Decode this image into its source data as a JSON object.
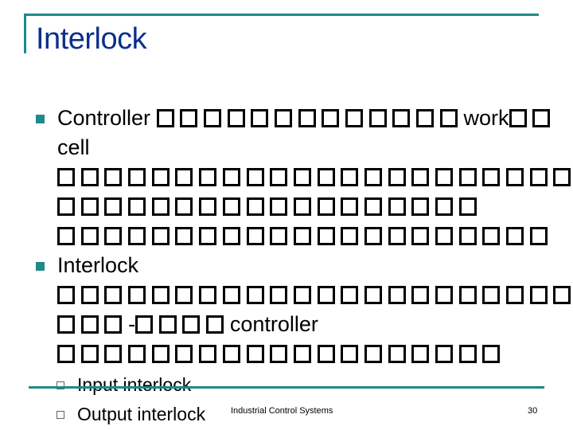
{
  "slide": {
    "title": "Interlock",
    "bullets": [
      {
        "lines": [
          {
            "segments": [
              {
                "text": "Controller "
              },
              {
                "tofu": 13
              },
              {
                "text": "work"
              },
              {
                "tofu": 2
              }
            ]
          },
          {
            "segments": [
              {
                "text": "cell"
              }
            ]
          },
          {
            "segments": [
              {
                "tofu": 22
              }
            ]
          },
          {
            "segments": [
              {
                "tofu": 18
              }
            ]
          },
          {
            "segments": [
              {
                "tofu": 21
              }
            ]
          }
        ],
        "plain_text": "Controller �������������work�� cell"
      },
      {
        "lines": [
          {
            "segments": [
              {
                "text": "Interlock"
              }
            ]
          },
          {
            "segments": [
              {
                "tofu": 22
              }
            ]
          },
          {
            "segments": [
              {
                "tofu": 3
              },
              {
                "text": "-"
              },
              {
                "tofu": 3
              },
              {
                "tofu": 1
              },
              {
                "text": "controller"
              }
            ]
          },
          {
            "segments": [
              {
                "tofu": 19
              }
            ]
          }
        ],
        "plain_text": "Interlock ���-��� � controller"
      }
    ],
    "sub_bullets": [
      {
        "label": "Input interlock"
      },
      {
        "label": "Output interlock"
      }
    ],
    "footer": "Industrial Control Systems",
    "page_number": "30"
  },
  "colors": {
    "title": "#0d2f8a",
    "accent": "#1e8a8a",
    "text": "#000000"
  }
}
